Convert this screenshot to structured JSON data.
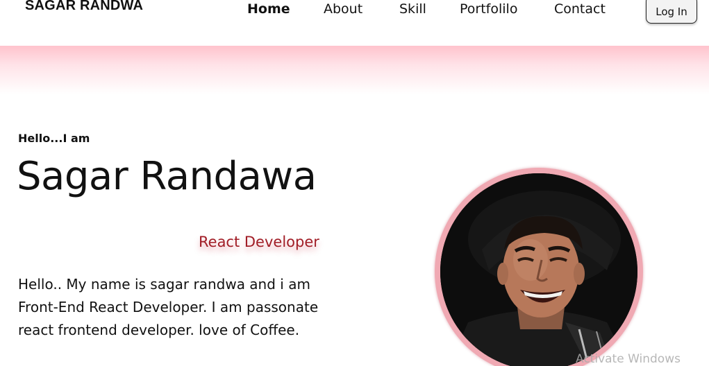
{
  "brand": {
    "name": "SAGAR RANDWA"
  },
  "nav": {
    "items": [
      {
        "label": "Home",
        "active": true
      },
      {
        "label": "About",
        "active": false
      },
      {
        "label": "Skill",
        "active": false
      },
      {
        "label": "Portfolilo",
        "active": false
      },
      {
        "label": "Contact",
        "active": false
      }
    ],
    "login_label": "Log In"
  },
  "hero": {
    "greeting": "Hello...I am",
    "name": "Sagar Randawa",
    "role": "React Developer",
    "bio_lines": [
      "Hello.. My name is sagar randwa and i am",
      "Front-End React Developer. I am passonate",
      "react frontend developer. love of Coffee."
    ]
  },
  "profile_image": {
    "icon": "profile-photo",
    "ring_color": "#f0a9b3"
  },
  "os_overlay": {
    "watermark": "Activate Windows"
  },
  "colors": {
    "accent": "#a11d26",
    "band": "#ffc3cc",
    "text": "#111111"
  }
}
